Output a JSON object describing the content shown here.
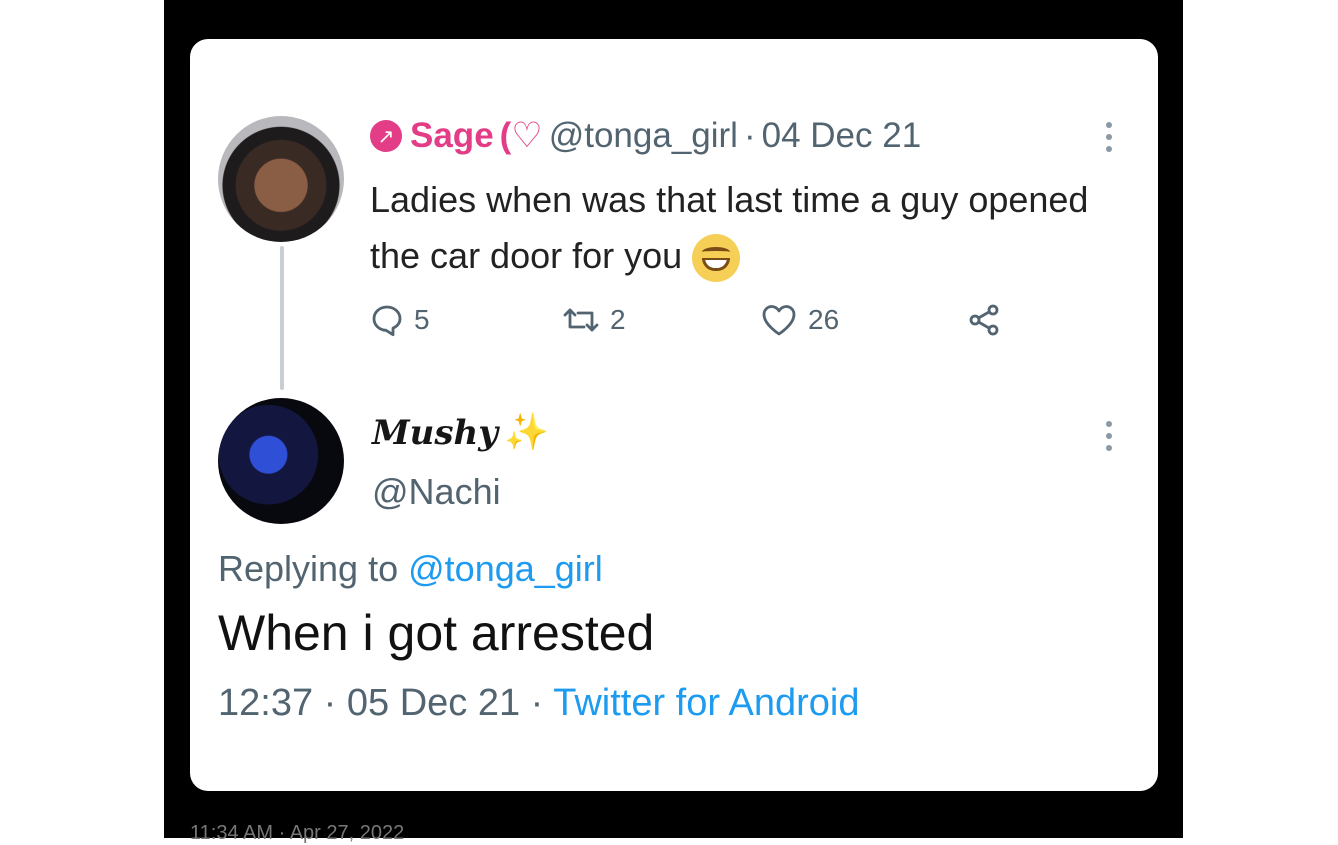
{
  "tweet_1": {
    "display_name": "Sage",
    "badge_icon": "pink-badge-icon",
    "heart_glyph": "(♡",
    "handle": "@tonga_girl",
    "separator": "·",
    "date": "04 Dec 21",
    "text": "Ladies when was that last time a guy opened the car door for you",
    "emoji": "grinning-face-icon",
    "reply_count": "5",
    "retweet_count": "2",
    "like_count": "26"
  },
  "tweet_2": {
    "display_name": "Mushy",
    "sparkles": "✨",
    "handle": "@Nachi",
    "replying_prefix": "Replying to",
    "replying_handle": "@tonga_girl",
    "text": "When i got arrested",
    "time": "12:37",
    "separator": "·",
    "date": "05 Dec 21",
    "source": "Twitter for Android"
  },
  "screen_timestamp": "11:34 AM · Apr 27, 2022",
  "colors": {
    "background": "#ffffff",
    "frame": "#000000",
    "text": "#222222",
    "muted": "#536471",
    "accent_pink": "#e23d86",
    "link": "#1d9bf0"
  }
}
